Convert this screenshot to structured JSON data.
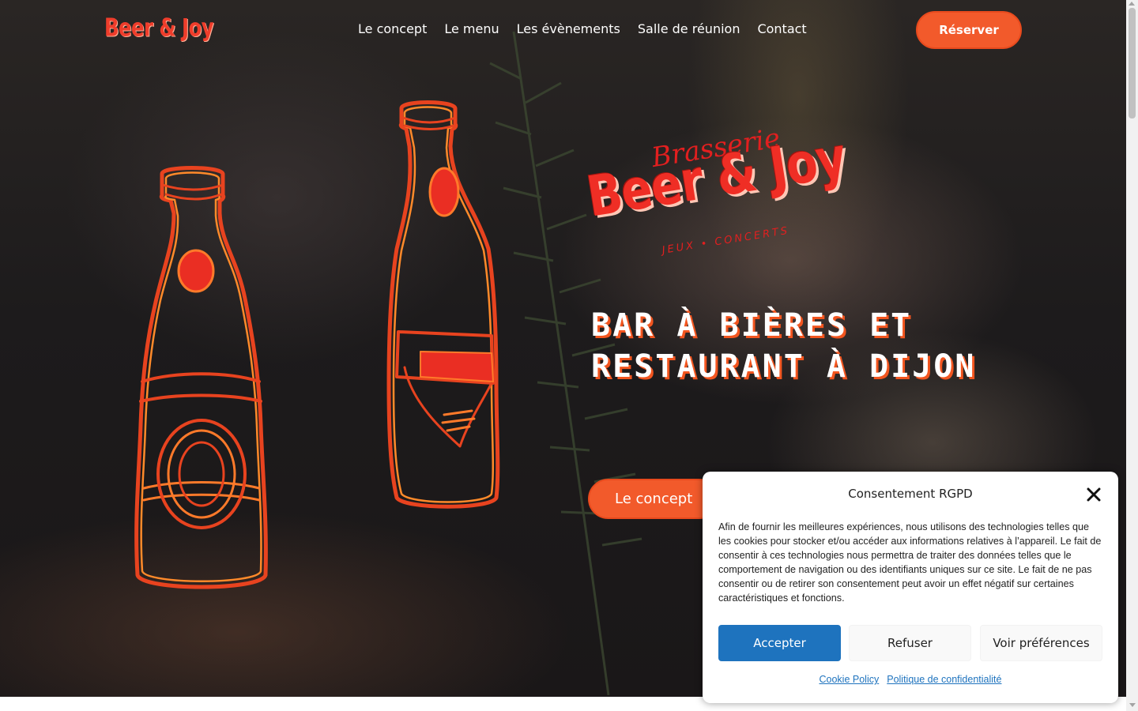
{
  "header": {
    "logo_text": "Beer & Joy",
    "nav": [
      "Le concept",
      "Le menu",
      "Les évènements",
      "Salle de réunion",
      "Contact"
    ],
    "reserve_label": "Réserver"
  },
  "hero": {
    "brand_brasserie": "Brasserie",
    "brand_name": "Beer & Joy",
    "brand_tagline": "JEUX • CONCERTS",
    "headline_line1": "BAR À BIÈRES ET",
    "headline_line2": "RESTAURANT À DIJON",
    "cta_label": "Le concept"
  },
  "consent": {
    "title": "Consentement RGPD",
    "text": "Afin de fournir les meilleures expériences, nous utilisons des technologies telles que les cookies pour stocker et/ou accéder aux informations relatives à l’appareil. Le fait de consentir à ces technologies nous permettra de traiter des données telles que le comportement de navigation ou des identifiants uniques sur ce site. Le fait de ne pas consentir ou de retirer son consentement peut avoir un effet négatif sur certaines caractéristiques et fonctions.",
    "accept_label": "Accepter",
    "refuse_label": "Refuser",
    "prefs_label": "Voir préférences",
    "link_cookie": "Cookie Policy",
    "link_privacy": "Politique de confidentialité"
  },
  "colors": {
    "accent": "#f25a2b",
    "brand_red": "#ef2e25",
    "consent_blue": "#1e73be"
  },
  "icons": [
    "close-icon",
    "beer-bottle-illustration",
    "rosemary-background"
  ]
}
